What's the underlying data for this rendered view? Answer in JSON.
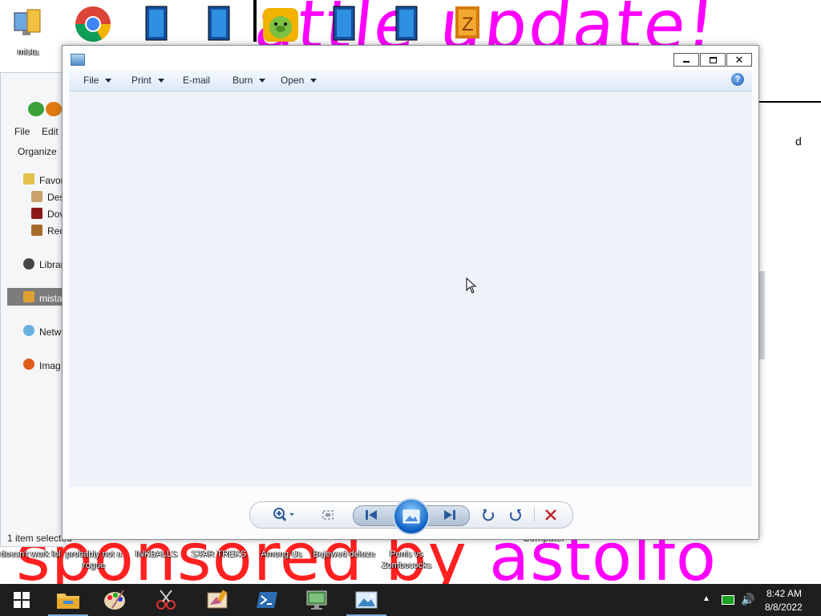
{
  "wallpaper": {
    "top_text": "attle update!",
    "bottom_red": "sponsored by",
    "bottom_pink": "astolfo"
  },
  "desktop_icons": [
    {
      "icon": "computer-icon",
      "label": "mista"
    },
    {
      "icon": "chrome-icon",
      "label": ""
    },
    {
      "icon": "game-icon",
      "label": ""
    },
    {
      "icon": "game-icon",
      "label": ""
    },
    {
      "icon": "bad-piggies-icon",
      "label": ""
    },
    {
      "icon": "game-icon",
      "label": ""
    },
    {
      "icon": "game-icon",
      "label": ""
    },
    {
      "icon": "game-icon",
      "label": ""
    }
  ],
  "desktop_bottom_labels": [
    "doesn't work lol",
    "probably not a rogue",
    "INKBALLS",
    "STAR TREKS",
    "Among Us",
    "Bejewed deluze",
    "Penis vs Zombococks"
  ],
  "explorer": {
    "menu": [
      "File",
      "Edit"
    ],
    "organize": "Organize",
    "nav": [
      "Favor",
      "Des",
      "Dov",
      "Rec",
      "Librar",
      "mista",
      "Netw",
      "Imag"
    ],
    "status": "1 item selected",
    "computer_label": "Computer",
    "partial_letter": "d"
  },
  "viewer": {
    "menu": [
      {
        "label": "File",
        "dropdown": true
      },
      {
        "label": "Print",
        "dropdown": true
      },
      {
        "label": "E-mail",
        "dropdown": false
      },
      {
        "label": "Burn",
        "dropdown": true
      },
      {
        "label": "Open",
        "dropdown": true
      }
    ],
    "help": "?",
    "controls": [
      "zoom-icon",
      "fit-window-icon",
      "previous-icon",
      "slideshow-icon",
      "next-icon",
      "rotate-left-icon",
      "rotate-right-icon",
      "delete-icon"
    ]
  },
  "taskbar": {
    "apps": [
      "file-explorer-icon",
      "paint-icon",
      "snipping-tool-icon",
      "paint-app-icon",
      "powershell-icon",
      "remote-desktop-icon",
      "photo-viewer-icon"
    ],
    "time": "8:42 AM",
    "date": "8/8/2022"
  }
}
